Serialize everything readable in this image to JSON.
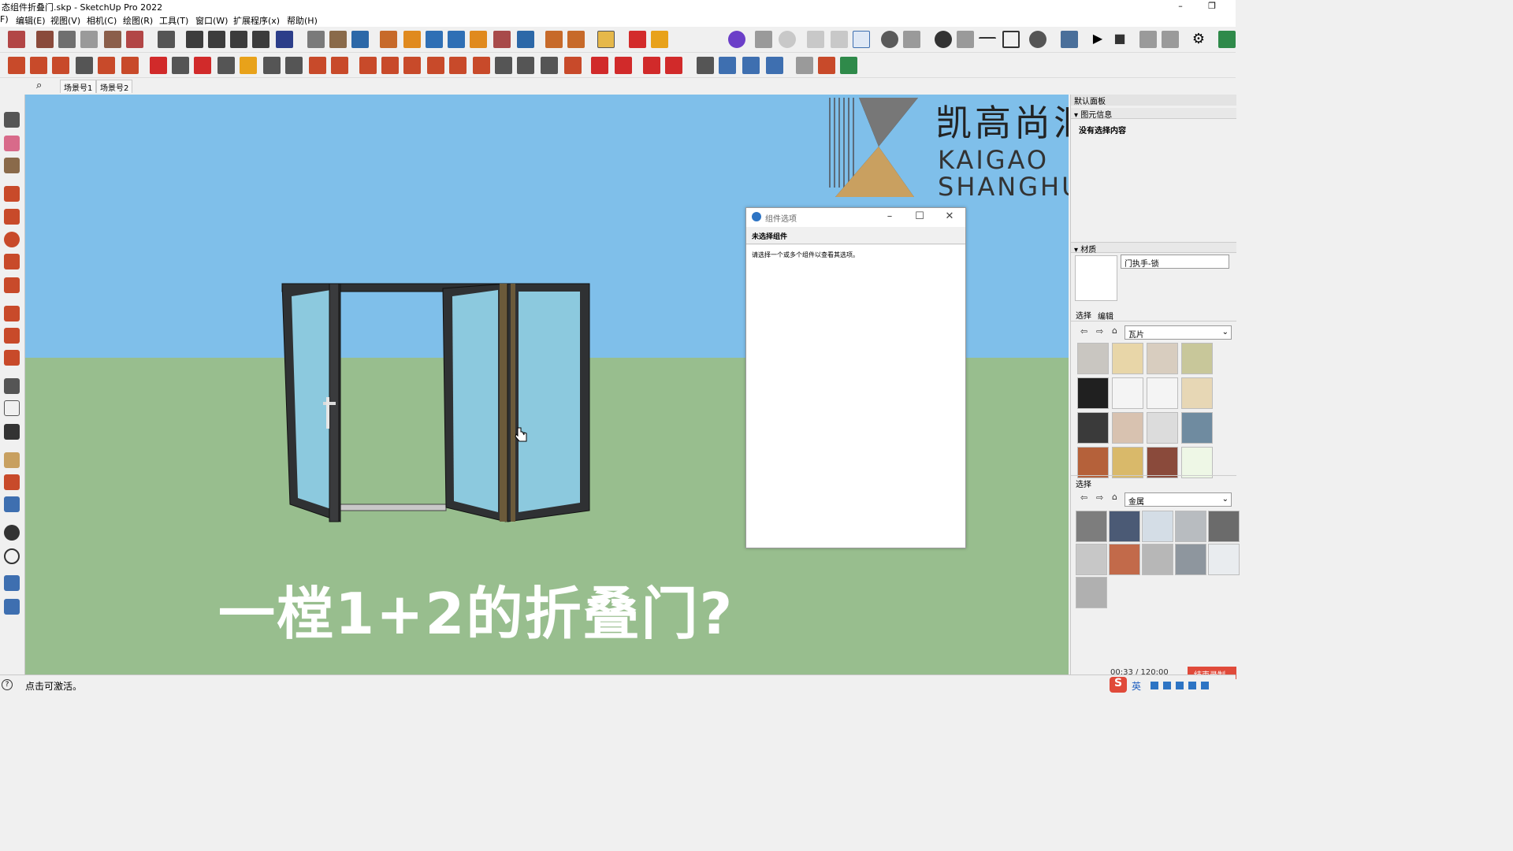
{
  "window": {
    "title": "态组件折叠门.skp - SketchUp Pro 2022",
    "minimize": "–",
    "restore": "❐"
  },
  "menu": [
    "F)",
    "编辑(E)",
    "视图(V)",
    "相机(C)",
    "绘图(R)",
    "工具(T)",
    "窗口(W)",
    "扩展程序(x)",
    "帮助(H)"
  ],
  "scenes": {
    "search_icon": "⌕",
    "tabs": [
      "场景号1",
      "场景号2"
    ]
  },
  "viewport": {
    "caption": "一樘1+2的折叠门?",
    "logo": {
      "cn": "凯高尚汇",
      "en_line1": "KAIGAO",
      "en_line2": "SHANGHUI"
    },
    "colors": {
      "sky": "#7fbfea",
      "ground": "#98be8e",
      "frame": "#2f3133",
      "glass": "#8cc9de"
    }
  },
  "dialog": {
    "title": "组件选项",
    "heading": "未选择组件",
    "message": "请选择一个或多个组件以查看其选项。",
    "min": "–",
    "max": "☐",
    "close": "✕"
  },
  "right_panel": {
    "default_tray": "默认面板",
    "entity_info": {
      "header": "图元信息",
      "status": "没有选择内容"
    },
    "materials": {
      "header": "材质",
      "name": "门执手-锁",
      "tabs": [
        "选择",
        "编辑"
      ],
      "collection1": "瓦片",
      "secondary_label": "选择",
      "collection2": "金属",
      "tiles_colors": [
        "#c9c6c1",
        "#e8d6a8",
        "#d8cdbf",
        "#c8c79a",
        "#202020",
        "#f4f4f4",
        "#f4f4f4",
        "#e7d7b5",
        "#3a3a3a",
        "#d8c2b0",
        "#dcdcdc",
        "#6f8ba0",
        "#b5613a",
        "#d9b96a",
        "#8a4a3b",
        "#eef7e6"
      ],
      "metal_colors": [
        "#7d7d7d",
        "#4b5a75",
        "#d4dde6",
        "#b8bcc0",
        "#6b6b6b",
        "#c7c7c7",
        "#c26a4a",
        "#b7b7b7",
        "#8e969e",
        "#e9ecef",
        "#b0b0b0"
      ]
    },
    "recording": {
      "time": "00:33 / 120:00",
      "stop_label": "结束录制"
    }
  },
  "status": {
    "info_icon": "?",
    "text": "点击可激活。",
    "ime": "英"
  }
}
